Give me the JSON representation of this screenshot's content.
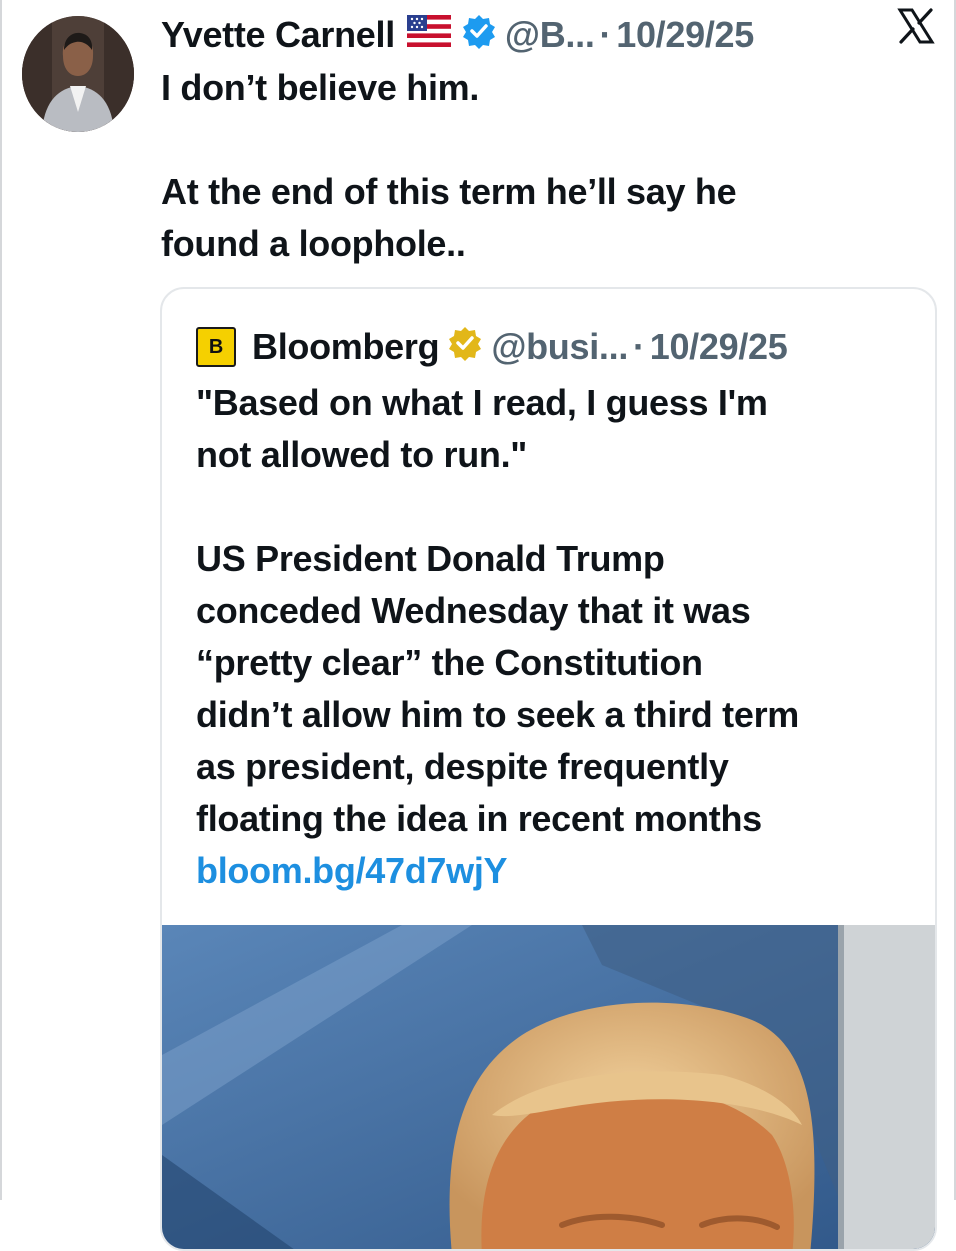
{
  "author": {
    "name": "Yvette Carnell",
    "flag": "🇺🇸",
    "handle": "@B...",
    "date": "10/29/25"
  },
  "tweet": {
    "line1": "I don’t believe him.",
    "line2": "At the end of this term he’ll say he",
    "line3": "found a loophole.."
  },
  "quoted": {
    "logo_letter": "B",
    "name": "Bloomberg",
    "handle": "@busi...",
    "date": "10/29/25",
    "quote_line1": "\"Based on what I read, I guess I'm",
    "quote_line2": "not allowed to run.\"",
    "body": [
      "US President Donald Trump",
      "conceded Wednesday that it was",
      "“pretty clear” the Constitution",
      "didn’t allow him to seek a third term",
      "as president, despite frequently",
      "floating the idea in recent months"
    ],
    "link": "bloom.bg/47d7wjY"
  },
  "separator_dot": "·",
  "icons": {
    "verified": "blue-verified-badge-icon",
    "gold_verified": "gold-verified-badge-icon",
    "platform": "x-logo-icon"
  },
  "colors": {
    "text": "#0f1419",
    "secondary": "#536471",
    "link": "#1d8fe0",
    "verified_blue": "#1d9bf0",
    "verified_gold": "#e2b719",
    "bloomberg_yellow": "#f5d000",
    "card_border": "#e4e7ea"
  }
}
